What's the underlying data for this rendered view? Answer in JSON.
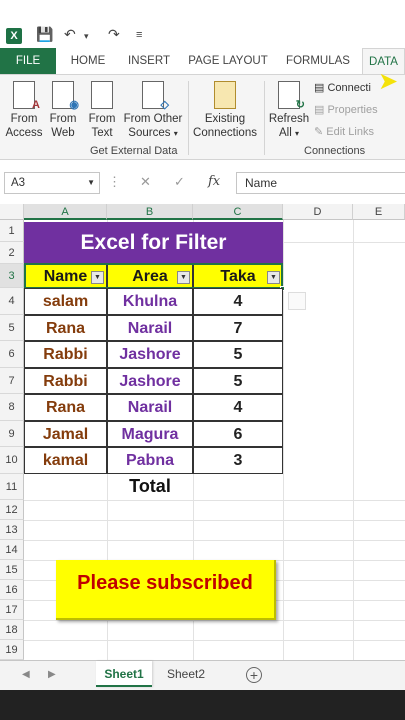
{
  "qat": {
    "excel_logo": "X"
  },
  "ribbon_tabs": [
    {
      "label": "FILE"
    },
    {
      "label": "HOME"
    },
    {
      "label": "INSERT"
    },
    {
      "label": "PAGE LAYOUT"
    },
    {
      "label": "FORMULAS"
    },
    {
      "label": "DATA"
    }
  ],
  "ribbon": {
    "from_access": "From\nAccess",
    "from_access_l1": "From",
    "from_access_l2": "Access",
    "from_web_l1": "From",
    "from_web_l2": "Web",
    "from_text_l1": "From",
    "from_text_l2": "Text",
    "from_other_l1": "From Other",
    "from_other_l2": "Sources",
    "existing_l1": "Existing",
    "existing_l2": "Connections",
    "group_external": "Get External Data",
    "refresh_l1": "Refresh",
    "refresh_l2": "All",
    "connections": "Connecti",
    "properties": "Properties",
    "edit_links": "Edit Links",
    "group_connections": "Connections"
  },
  "formula_bar": {
    "name_box": "A3",
    "cancel": "✕",
    "enter": "✓",
    "fx": "fx",
    "value": "Name"
  },
  "columns": [
    "A",
    "B",
    "C",
    "D",
    "E"
  ],
  "rows": [
    "1",
    "2",
    "3",
    "4",
    "5",
    "6",
    "7",
    "8",
    "9",
    "10",
    "11",
    "12",
    "13",
    "14",
    "15",
    "16",
    "17",
    "18",
    "19"
  ],
  "sheet": {
    "title": "Excel for  Filter",
    "headers": {
      "name": "Name",
      "area": "Area",
      "taka": "Taka"
    },
    "records": [
      {
        "name": "salam",
        "area": "Khulna",
        "taka": "4"
      },
      {
        "name": "Rana",
        "area": "Narail",
        "taka": "7"
      },
      {
        "name": "Rabbi",
        "area": "Jashore",
        "taka": "5"
      },
      {
        "name": "Rabbi",
        "area": "Jashore",
        "taka": "5"
      },
      {
        "name": "Rana",
        "area": "Narail",
        "taka": "4"
      },
      {
        "name": "Jamal",
        "area": "Magura",
        "taka": "6"
      },
      {
        "name": "kamal",
        "area": "Pabna",
        "taka": "3"
      }
    ],
    "total_label": "Total",
    "banner": "Please subscribed"
  },
  "sheet_tabs": [
    {
      "label": "Sheet1"
    },
    {
      "label": "Sheet2"
    }
  ],
  "colors": {
    "excel_green": "#217346",
    "title_fill": "#7030a0",
    "header_fill": "#ffff00",
    "name_text": "#843c0c",
    "area_text": "#7030a0",
    "banner_text": "#c00000"
  }
}
